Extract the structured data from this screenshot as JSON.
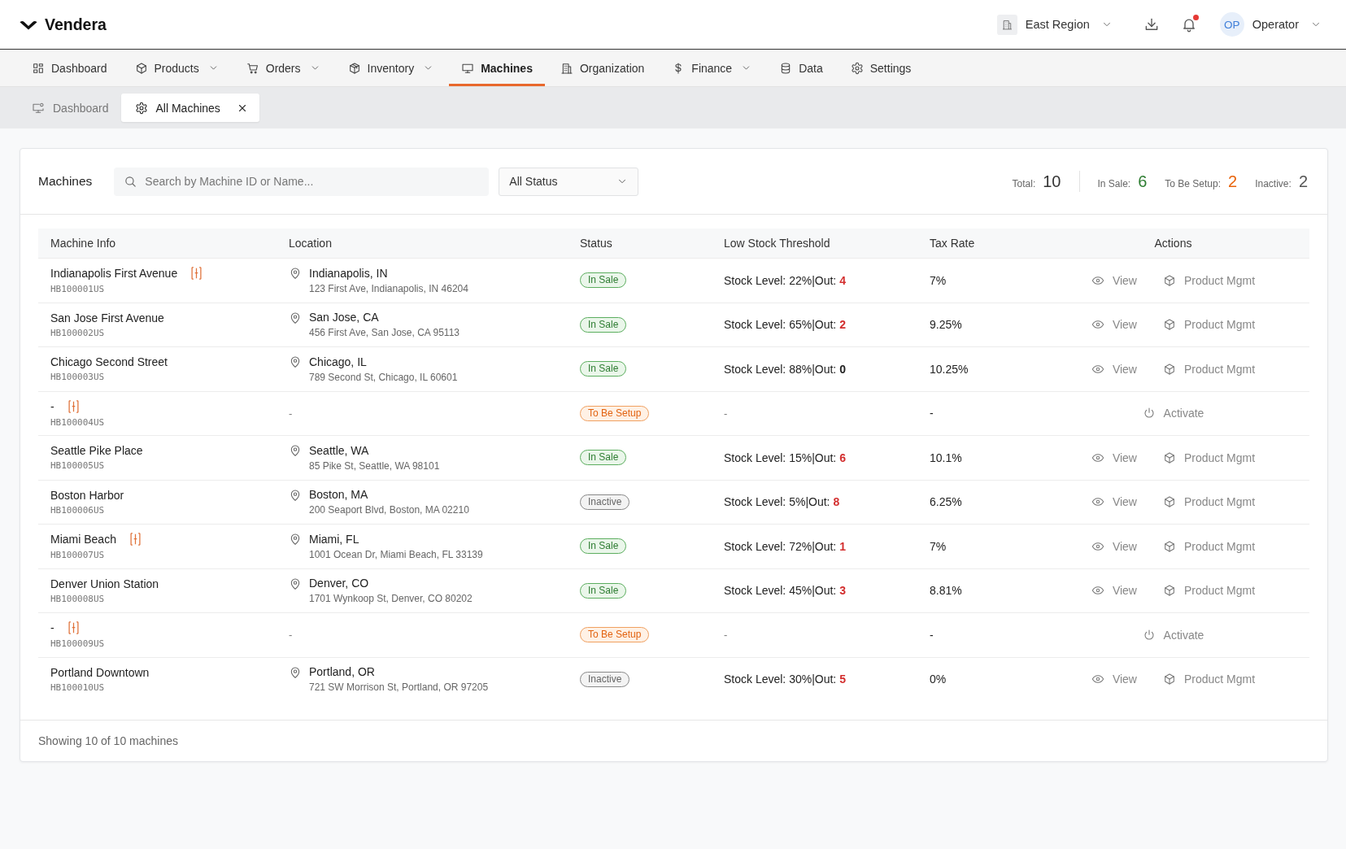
{
  "brand": {
    "name": "Vendera"
  },
  "header": {
    "region": "East Region",
    "notifications": {
      "unread": true
    },
    "user": {
      "initials": "OP",
      "name": "Operator"
    }
  },
  "nav": [
    {
      "label": "Dashboard",
      "has_menu": false,
      "selected": false
    },
    {
      "label": "Products",
      "has_menu": true,
      "selected": false
    },
    {
      "label": "Orders",
      "has_menu": true,
      "selected": false
    },
    {
      "label": "Inventory",
      "has_menu": true,
      "selected": false
    },
    {
      "label": "Machines",
      "has_menu": false,
      "selected": true
    },
    {
      "label": "Organization",
      "has_menu": false,
      "selected": false
    },
    {
      "label": "Finance",
      "has_menu": true,
      "selected": false
    },
    {
      "label": "Data",
      "has_menu": false,
      "selected": false
    },
    {
      "label": "Settings",
      "has_menu": false,
      "selected": false
    }
  ],
  "tabs": [
    {
      "label": "Dashboard",
      "selected": false,
      "closable": false
    },
    {
      "label": "All Machines",
      "selected": true,
      "closable": true
    }
  ],
  "panel": {
    "title": "Machines",
    "search": {
      "placeholder": "Search by Machine ID or Name..."
    },
    "status_filter": {
      "value": "All Status"
    },
    "stats": [
      {
        "label": "Total:",
        "value": "10",
        "color": "#333333"
      },
      {
        "label": "In Sale:",
        "value": "6",
        "color": "#2e7d32"
      },
      {
        "label": "To Be Setup:",
        "value": "2",
        "color": "#e8640c"
      },
      {
        "label": "Inactive:",
        "value": "2",
        "color": "#555555"
      }
    ]
  },
  "table": {
    "columns": [
      "Machine Info",
      "Location",
      "Status",
      "Low Stock Threshold",
      "Tax Rate",
      "Actions"
    ],
    "rows": [
      {
        "name": "Indianapolis First Avenue",
        "flagged": true,
        "id": "HB100001US",
        "location": {
          "kind": "address",
          "city": "Indianapolis, IN",
          "address": "123 First Ave, Indianapolis, IN 46204"
        },
        "status": {
          "kind": "in_sale",
          "label": "In Sale"
        },
        "stock": {
          "kind": "level",
          "text": "Stock Level: 22%|Out:",
          "out": "4",
          "alert": true
        },
        "tax": "7%",
        "actions": [
          {
            "kind": "view",
            "label": "View"
          },
          {
            "kind": "product",
            "label": "Product Mgmt"
          }
        ]
      },
      {
        "name": "San Jose First Avenue",
        "flagged": false,
        "id": "HB100002US",
        "location": {
          "kind": "address",
          "city": "San Jose, CA",
          "address": "456 First Ave, San Jose, CA 95113"
        },
        "status": {
          "kind": "in_sale",
          "label": "In Sale"
        },
        "stock": {
          "kind": "level",
          "text": "Stock Level: 65%|Out:",
          "out": "2",
          "alert": true
        },
        "tax": "9.25%",
        "actions": [
          {
            "kind": "view",
            "label": "View"
          },
          {
            "kind": "product",
            "label": "Product Mgmt"
          }
        ]
      },
      {
        "name": "Chicago Second Street",
        "flagged": false,
        "id": "HB100003US",
        "location": {
          "kind": "address",
          "city": "Chicago, IL",
          "address": "789 Second St, Chicago, IL 60601"
        },
        "status": {
          "kind": "in_sale",
          "label": "In Sale"
        },
        "stock": {
          "kind": "level",
          "text": "Stock Level: 88%|Out:",
          "out": "0",
          "alert": false
        },
        "tax": "10.25%",
        "actions": [
          {
            "kind": "view",
            "label": "View"
          },
          {
            "kind": "product",
            "label": "Product Mgmt"
          }
        ]
      },
      {
        "name": "-",
        "flagged": true,
        "id": "HB100004US",
        "location": {
          "kind": "none",
          "city": "-"
        },
        "status": {
          "kind": "to_be_setup",
          "label": "To Be Setup"
        },
        "stock": {
          "kind": "none",
          "text": "-"
        },
        "tax": "-",
        "actions": [
          {
            "kind": "activate",
            "label": "Activate"
          }
        ]
      },
      {
        "name": "Seattle Pike Place",
        "flagged": false,
        "id": "HB100005US",
        "location": {
          "kind": "address",
          "city": "Seattle, WA",
          "address": "85 Pike St, Seattle, WA 98101"
        },
        "status": {
          "kind": "in_sale",
          "label": "In Sale"
        },
        "stock": {
          "kind": "level",
          "text": "Stock Level: 15%|Out:",
          "out": "6",
          "alert": true
        },
        "tax": "10.1%",
        "actions": [
          {
            "kind": "view",
            "label": "View"
          },
          {
            "kind": "product",
            "label": "Product Mgmt"
          }
        ]
      },
      {
        "name": "Boston Harbor",
        "flagged": false,
        "id": "HB100006US",
        "location": {
          "kind": "address",
          "city": "Boston, MA",
          "address": "200 Seaport Blvd, Boston, MA 02210"
        },
        "status": {
          "kind": "inactive",
          "label": "Inactive"
        },
        "stock": {
          "kind": "level",
          "text": "Stock Level: 5%|Out:",
          "out": "8",
          "alert": true
        },
        "tax": "6.25%",
        "actions": [
          {
            "kind": "view",
            "label": "View"
          },
          {
            "kind": "product",
            "label": "Product Mgmt"
          }
        ]
      },
      {
        "name": "Miami Beach",
        "flagged": true,
        "id": "HB100007US",
        "location": {
          "kind": "address",
          "city": "Miami, FL",
          "address": "1001 Ocean Dr, Miami Beach, FL 33139"
        },
        "status": {
          "kind": "in_sale",
          "label": "In Sale"
        },
        "stock": {
          "kind": "level",
          "text": "Stock Level: 72%|Out:",
          "out": "1",
          "alert": true
        },
        "tax": "7%",
        "actions": [
          {
            "kind": "view",
            "label": "View"
          },
          {
            "kind": "product",
            "label": "Product Mgmt"
          }
        ]
      },
      {
        "name": "Denver Union Station",
        "flagged": false,
        "id": "HB100008US",
        "location": {
          "kind": "address",
          "city": "Denver, CO",
          "address": "1701 Wynkoop St, Denver, CO 80202"
        },
        "status": {
          "kind": "in_sale",
          "label": "In Sale"
        },
        "stock": {
          "kind": "level",
          "text": "Stock Level: 45%|Out:",
          "out": "3",
          "alert": true
        },
        "tax": "8.81%",
        "actions": [
          {
            "kind": "view",
            "label": "View"
          },
          {
            "kind": "product",
            "label": "Product Mgmt"
          }
        ]
      },
      {
        "name": "-",
        "flagged": true,
        "id": "HB100009US",
        "location": {
          "kind": "none",
          "city": "-"
        },
        "status": {
          "kind": "to_be_setup",
          "label": "To Be Setup"
        },
        "stock": {
          "kind": "none",
          "text": "-"
        },
        "tax": "-",
        "actions": [
          {
            "kind": "activate",
            "label": "Activate"
          }
        ]
      },
      {
        "name": "Portland Downtown",
        "flagged": false,
        "id": "HB100010US",
        "location": {
          "kind": "address",
          "city": "Portland, OR",
          "address": "721 SW Morrison St, Portland, OR 97205"
        },
        "status": {
          "kind": "inactive",
          "label": "Inactive"
        },
        "stock": {
          "kind": "level",
          "text": "Stock Level: 30%|Out:",
          "out": "5",
          "alert": true
        },
        "tax": "0%",
        "actions": [
          {
            "kind": "view",
            "label": "View"
          },
          {
            "kind": "product",
            "label": "Product Mgmt"
          }
        ]
      }
    ]
  },
  "footer": {
    "text": "Showing 10 of 10 machines"
  }
}
